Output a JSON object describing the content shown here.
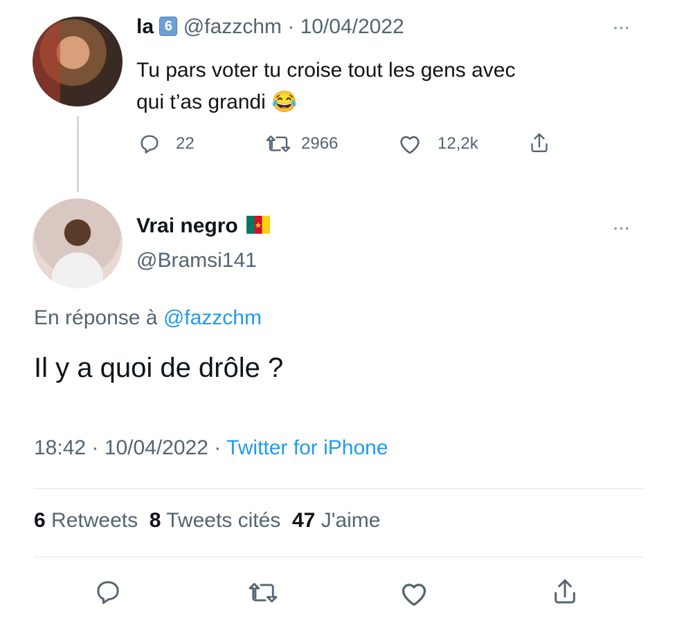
{
  "parent_tweet": {
    "display_name": "la",
    "badge": "6",
    "handle": "@fazzchm",
    "sep": "·",
    "date": "10/04/2022",
    "text_line1": "Tu pars voter tu croise tout les gens avec",
    "text_line2": "qui t’as grandi",
    "emoji": "😂",
    "replies": "22",
    "retweets": "2966",
    "likes": "12,2k",
    "more": "···"
  },
  "reply_tweet": {
    "display_name": "Vrai negro",
    "handle": "@Bramsi141",
    "more": "···",
    "replying_prefix": "En réponse à",
    "replying_handle": "@fazzchm",
    "text": "Il y a quoi de drôle ?",
    "time": "18:42",
    "sep1": "·",
    "date": "10/04/2022",
    "sep2": "·",
    "source": "Twitter for iPhone",
    "stats": {
      "retweets_count": "6",
      "retweets_label": "Retweets",
      "quotes_count": "8",
      "quotes_label": "Tweets cités",
      "likes_count": "47",
      "likes_label": "J'aime"
    }
  },
  "icons": {
    "reply": "reply-icon",
    "retweet": "retweet-icon",
    "like": "heart-icon",
    "share": "share-icon",
    "flag": "cameroon-flag-icon"
  },
  "colors": {
    "link": "#1d9bf0",
    "muted": "#536471",
    "text": "#0f1419",
    "flag_green": "#007a5e",
    "flag_red": "#ce1126",
    "flag_yellow": "#fcd116"
  }
}
